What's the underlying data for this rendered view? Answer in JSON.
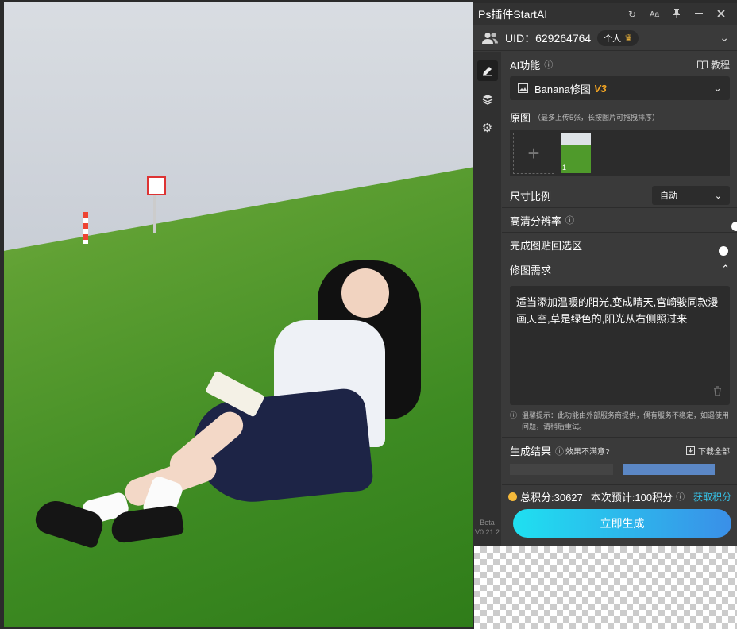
{
  "panel": {
    "title": "Ps插件StartAI",
    "titlebar_icons": [
      "refresh-icon",
      "font-size-icon",
      "pin-icon",
      "minimize-icon",
      "close-icon"
    ],
    "uid": "UID：629264764",
    "account_badge": "个人",
    "version_line1": "Beta",
    "version_line2": "V0.21.2"
  },
  "ai": {
    "section_label": "AI功能",
    "tutorial_label": "教程",
    "mode": "Banana修图",
    "mode_tag": "V3"
  },
  "original": {
    "label": "原图",
    "hint": "（最多上传5张，长按图片可拖拽排序）",
    "thumb_index": "1"
  },
  "settings": {
    "ratio_label": "尺寸比例",
    "ratio_value": "自动",
    "hd_label": "高清分辨率",
    "hd_on": false,
    "paste_label": "完成图贴回选区",
    "paste_on": true
  },
  "prompt": {
    "label": "修图需求",
    "text": "适当添加温暖的阳光,变成晴天,宫崎骏同款漫画天空,草是绿色的,阳光从右侧照过来",
    "notice": "温馨提示：此功能由外部服务商提供，偶有服务不稳定，如遇使用问题，请稍后重试。"
  },
  "results": {
    "label": "生成结果",
    "feedback": "效果不满意?",
    "download_all": "下载全部"
  },
  "footer": {
    "total_credits": "总积分:30627",
    "estimate": "本次预计:100积分",
    "get_credits": "获取积分",
    "generate_button": "立即生成"
  },
  "colors": {
    "accent": "#2aa9e0",
    "button_gradient_start": "#1fe0f0",
    "button_gradient_end": "#3a8fe8",
    "v3_tag": "#f5a623",
    "coin": "#f5b93a"
  }
}
